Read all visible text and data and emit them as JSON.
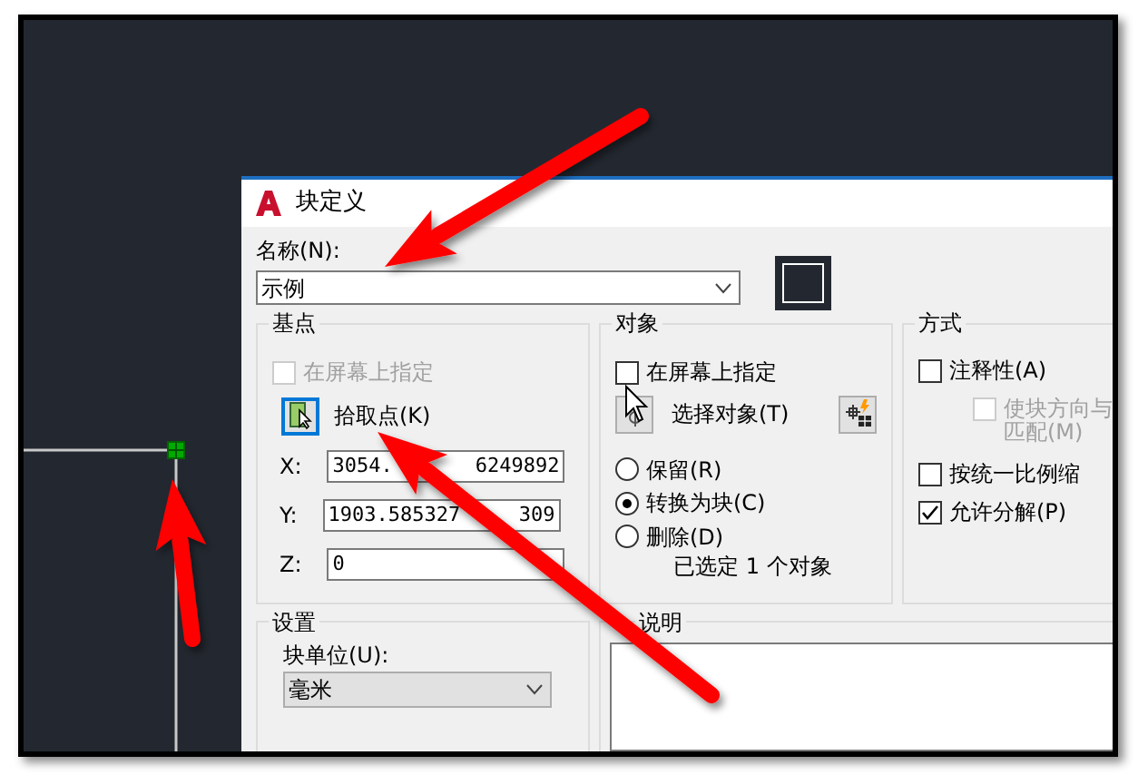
{
  "window": {
    "title": "块定义"
  },
  "name": {
    "label": "名称(N):",
    "value": "示例"
  },
  "base_point": {
    "title": "基点",
    "specify_on_screen": {
      "label": "在屏幕上指定",
      "checked": false,
      "disabled": true
    },
    "pick_button": {
      "label": "拾取点(K)"
    },
    "coords": [
      {
        "label": "X:",
        "value": "3054.",
        "value_tail": "6249892"
      },
      {
        "label": "Y:",
        "value": "1903.585327",
        "value_tail": "309"
      },
      {
        "label": "Z:",
        "value": "0"
      }
    ]
  },
  "objects": {
    "title": "对象",
    "specify_on_screen": {
      "label": "在屏幕上指定",
      "checked": false
    },
    "select_button": {
      "label": "选择对象(T)"
    },
    "options": [
      {
        "label": "保留(R)",
        "selected": false
      },
      {
        "label": "转换为块(C)",
        "selected": true
      },
      {
        "label": "删除(D)",
        "selected": false
      }
    ],
    "summary": "已选定 1 个对象"
  },
  "behavior": {
    "title": "方式",
    "options": [
      {
        "lines": [
          "注释性(A)"
        ],
        "checked": false,
        "disabled": false,
        "indented": false
      },
      {
        "lines": [
          "使块方向与",
          "匹配(M)"
        ],
        "checked": false,
        "disabled": true,
        "indented": true
      },
      {
        "lines": [
          "按统一比例缩"
        ],
        "checked": false,
        "disabled": false,
        "indented": false
      },
      {
        "lines": [
          "允许分解(P)"
        ],
        "checked": true,
        "disabled": false,
        "indented": false
      }
    ]
  },
  "settings": {
    "title": "设置",
    "unit_label": "块单位(U):",
    "unit": "毫米"
  },
  "description": {
    "title": "说明"
  }
}
